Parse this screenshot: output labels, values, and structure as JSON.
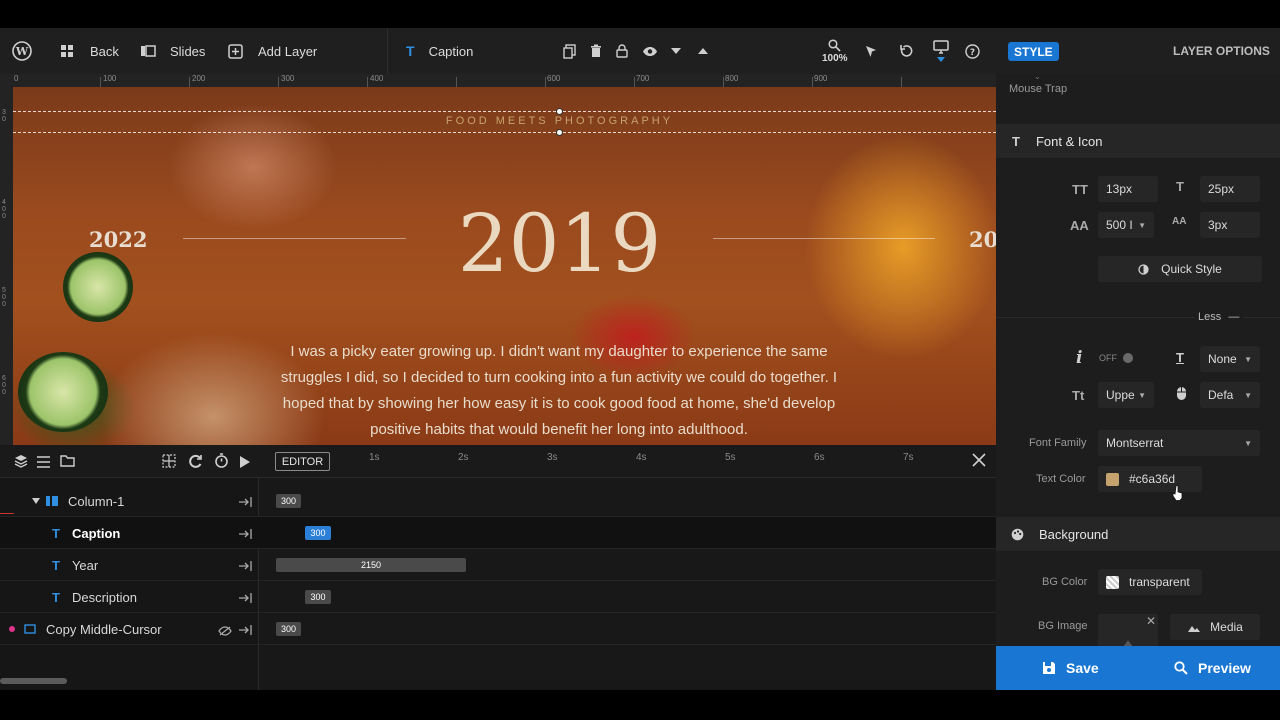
{
  "toolbar": {
    "back_label": "Back",
    "slides_label": "Slides",
    "add_layer_label": "Add Layer",
    "layer_type_label": "Caption",
    "zoom_label": "100%"
  },
  "ruler": {
    "marks": [
      "0",
      "100",
      "200",
      "300",
      "400",
      "500",
      "600",
      "700",
      "800",
      "900"
    ],
    "vmarks": [
      "3 0",
      "4 0 0",
      "5 0 0",
      "6 0 0"
    ]
  },
  "canvas": {
    "caption": "FOOD MEETS PHOTOGRAPHY",
    "year_prev": "2022",
    "year_main": "2019",
    "year_next": "20",
    "description": "I was a picky eater growing up. I didn't want my daughter to experience the same struggles I did, so I decided to turn cooking into a fun activity we could do together. I hoped that by showing her how easy it is to cook good food at home, she'd develop positive habits that would benefit her long into adulthood."
  },
  "timeline": {
    "editor_label": "EDITOR",
    "time_marks": [
      "1s",
      "2s",
      "3s",
      "4s",
      "5s",
      "6s",
      "7s"
    ],
    "rows": [
      {
        "name": "Column-1",
        "bar_label": "300"
      },
      {
        "name": "Caption",
        "bar_label": "300"
      },
      {
        "name": "Year",
        "bar_label": "2150"
      },
      {
        "name": "Description",
        "bar_label": "300"
      },
      {
        "name": "Copy Middle-Cursor",
        "bar_label": "300"
      }
    ]
  },
  "panel": {
    "style_tab": "STYLE",
    "layer_options_tab": "LAYER OPTIONS",
    "mouse_trap_label": "Mouse Trap",
    "font_icon_section": "Font & Icon",
    "font_size": "13px",
    "line_height": "25px",
    "font_weight": "500 I",
    "letter_spacing": "3px",
    "quick_style_label": "Quick Style",
    "less_label": "Less",
    "italic_toggle": "OFF",
    "text_decoration": "None",
    "text_transform": "Uppe",
    "cursor": "Defa",
    "font_family_label": "Font Family",
    "font_family_value": "Montserrat",
    "text_color_label": "Text Color",
    "text_color_value": "#c6a36d",
    "background_section": "Background",
    "bg_color_label": "BG Color",
    "bg_color_value": "transparent",
    "bg_image_label": "BG Image",
    "media_label": "Media"
  },
  "footer": {
    "save_label": "Save",
    "preview_label": "Preview"
  },
  "colors": {
    "accent": "#1976d2",
    "text_swatch": "#c6a36d",
    "caption_bar": "#2b7fd6",
    "grey_bar": "#4a4a4a"
  }
}
